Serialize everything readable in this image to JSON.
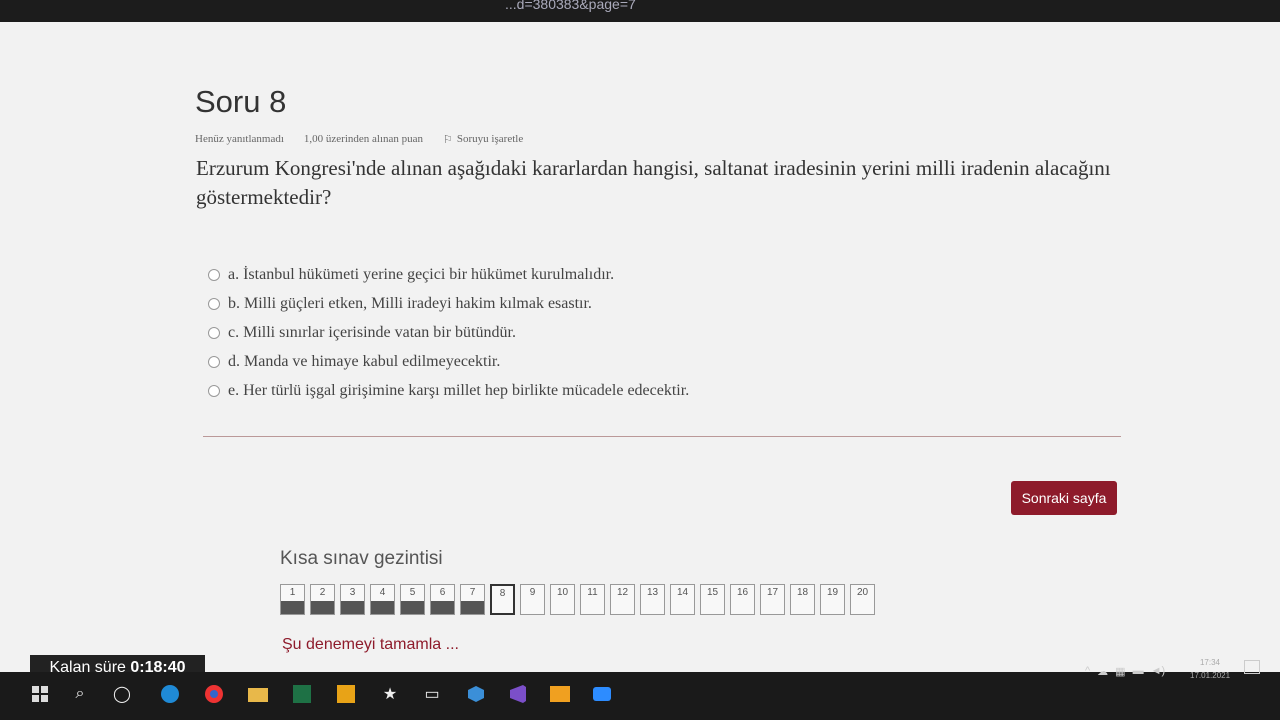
{
  "browser": {
    "url_fragment": "...d=380383&page=7",
    "star_icon": "star-icon",
    "menu_icon": "reading-list-icon"
  },
  "quiz": {
    "title": "Soru 8",
    "status": "Henüz yanıtlanmadı",
    "points": "1,00 üzerinden alınan puan",
    "flag_label": "Soruyu işaretle",
    "question": "Erzurum Kongresi'nde alınan aşağıdaki kararlardan hangisi, saltanat iradesinin yerini milli iradenin alacağını göstermektedir?",
    "options": [
      "a. İstanbul hükümeti yerine geçici bir hükümet kurulmalıdır.",
      "b. Milli güçleri etken, Milli iradeyi hakim kılmak esastır.",
      "c. Milli sınırlar içerisinde vatan bir bütündür.",
      "d. Manda ve himaye kabul edilmeyecektir.",
      "e. Her türlü işgal girişimine karşı millet hep birlikte mücadele edecektir."
    ],
    "next_button": "Sonraki sayfa"
  },
  "navigation": {
    "title": "Kısa sınav gezintisi",
    "buttons": [
      "1",
      "2",
      "3",
      "4",
      "5",
      "6",
      "7",
      "8",
      "9",
      "10",
      "11",
      "12",
      "13",
      "14",
      "15",
      "16",
      "17",
      "18",
      "19",
      "20"
    ],
    "finish_link": "Şu denemeyi tamamla ..."
  },
  "timer": {
    "label": "Kalan süre",
    "value": "0:18:40"
  },
  "taskbar": {
    "time": "17:34",
    "date": "17.01.2021"
  }
}
